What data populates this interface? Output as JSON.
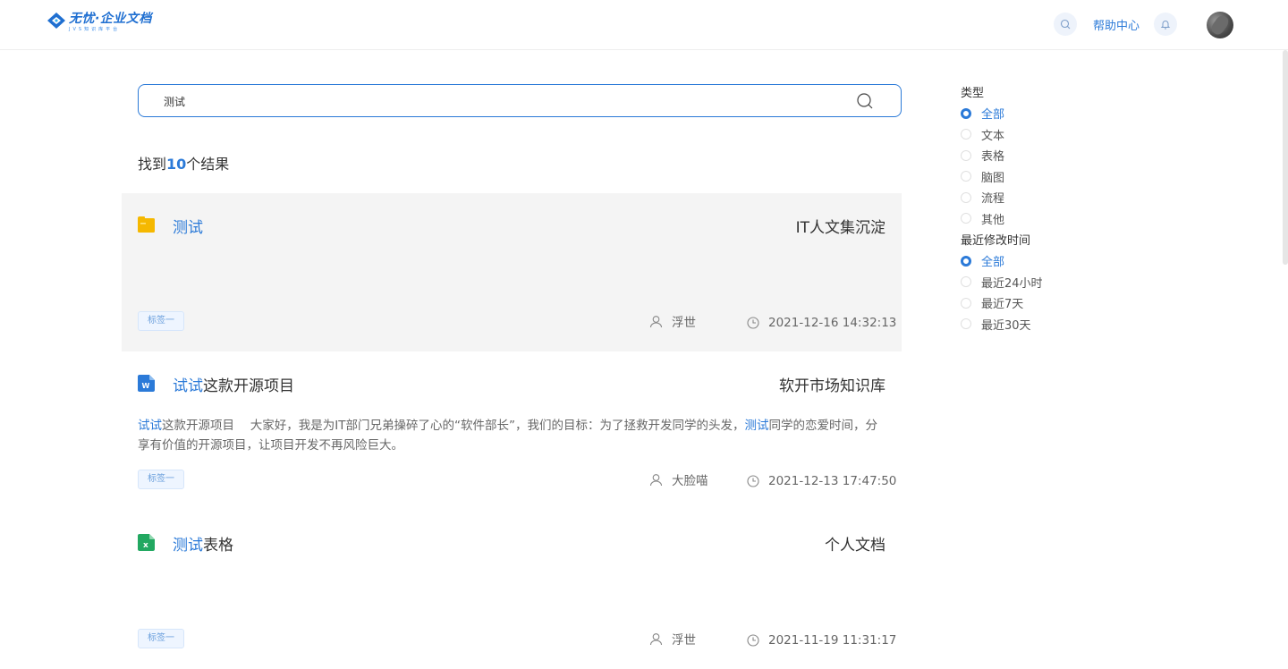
{
  "header": {
    "logo_text": "无忧·企业文档",
    "logo_sub": "JVS知识库平台",
    "help_label": "帮助中心",
    "search_icon": "search-icon",
    "bell_icon": "bell-icon"
  },
  "search": {
    "value": "测试",
    "placeholder": ""
  },
  "results": {
    "prefix": "找到",
    "count": "10",
    "suffix": "个结果",
    "items": [
      {
        "icon": "folder-icon",
        "title_highlight": "测试",
        "title_rest": "",
        "knowledge_base": "IT人文集沉淀",
        "snippet_parts": [],
        "tag": "标签一",
        "author": "浮世",
        "time": "2021-12-16 14:32:13"
      },
      {
        "icon": "word-doc-icon",
        "title_highlight": "试试",
        "title_rest": "这款开源项目",
        "knowledge_base": "软开市场知识库",
        "snippet_hl1": "试试",
        "snippet_t1": "这款开源项目　 大家好，我是为IT部门兄弟操碎了心的“软件部长”，我们的目标：为了拯救开发同学的头发，",
        "snippet_hl2": "测试",
        "snippet_t2": "同学的恋爱时间，分享有价值的开源项目，让项目开发不再风险巨大。",
        "tag": "标签一",
        "author": "大脸喵",
        "time": "2021-12-13 17:47:50"
      },
      {
        "icon": "excel-sheet-icon",
        "title_highlight": "测试",
        "title_rest": "表格",
        "knowledge_base": "个人文档",
        "tag": "标签一",
        "author": "浮世",
        "time": "2021-11-19 11:31:17"
      }
    ]
  },
  "filters": {
    "type_title": "类型",
    "type_options": [
      "全部",
      "文本",
      "表格",
      "脑图",
      "流程",
      "其他"
    ],
    "type_selected": "全部",
    "time_title": "最近修改时间",
    "time_options": [
      "全部",
      "最近24小时",
      "最近7天",
      "最近30天"
    ],
    "time_selected": "全部"
  },
  "colors": {
    "accent": "#2b7ad8",
    "folder": "#f5b800",
    "word": "#2b7ad8",
    "excel": "#22a861"
  }
}
